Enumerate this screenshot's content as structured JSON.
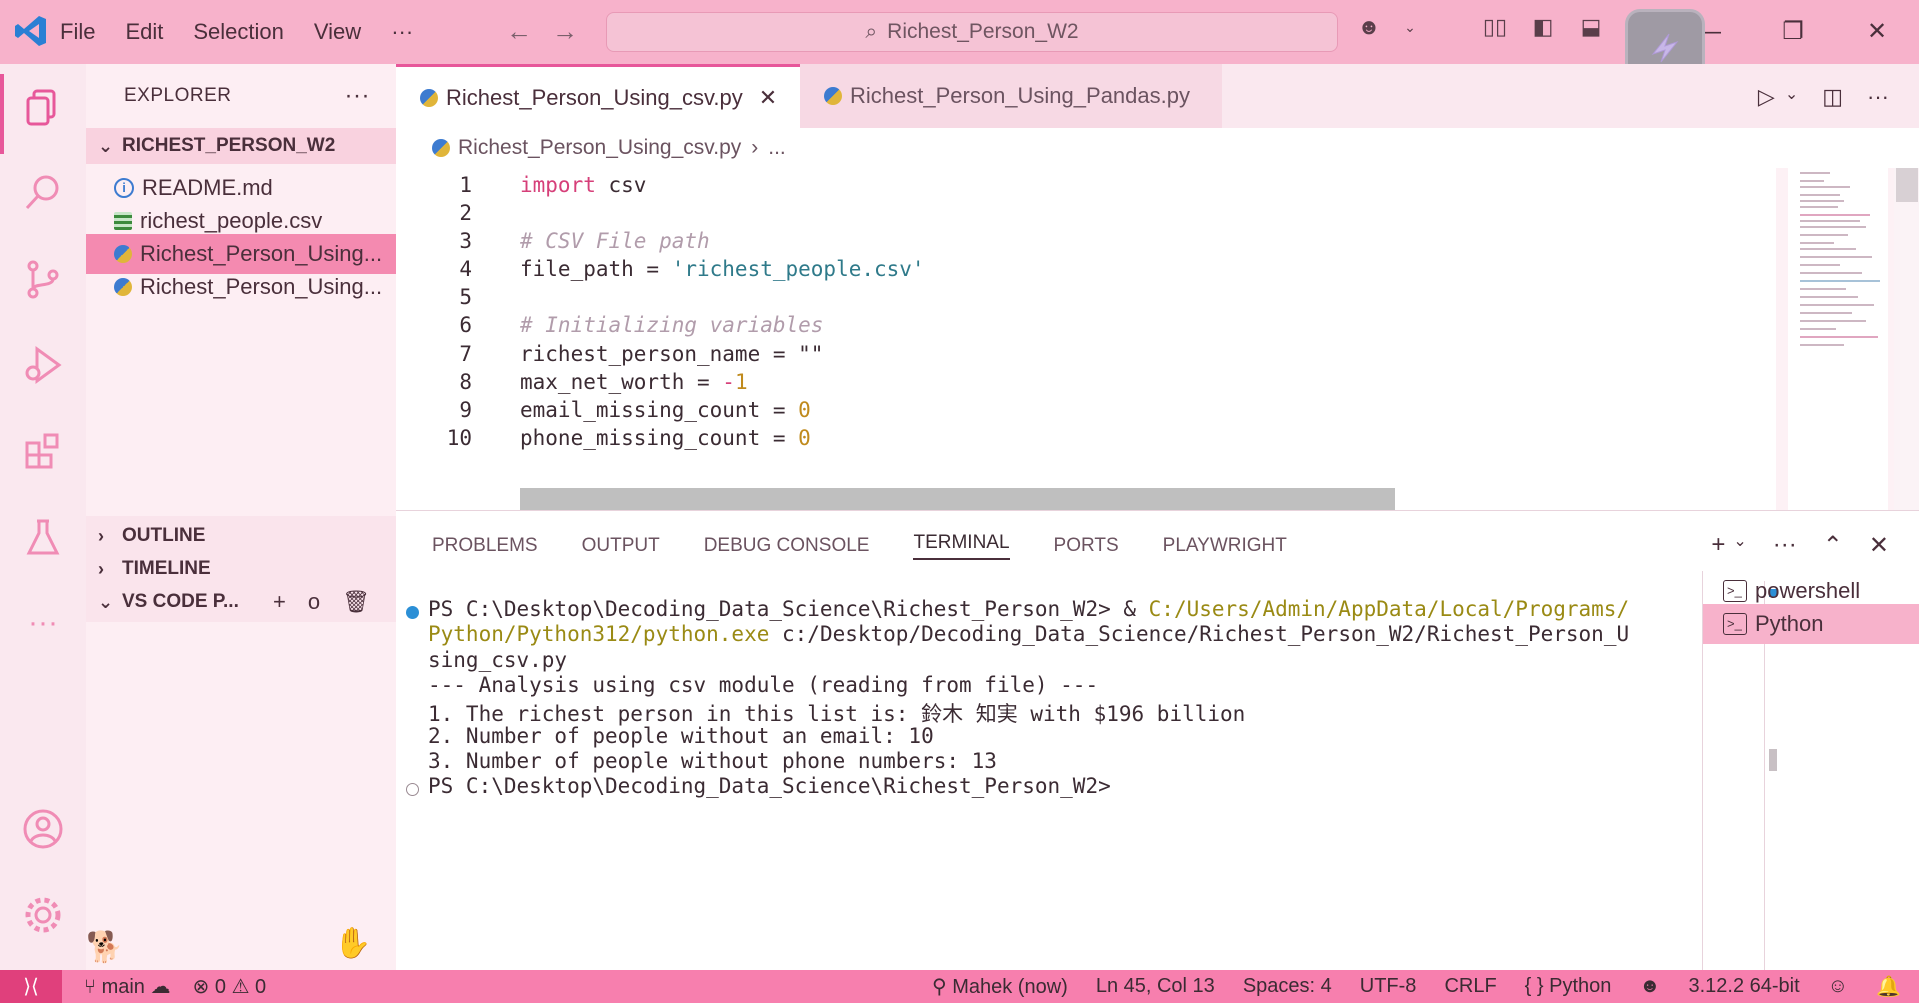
{
  "titlebar": {
    "menu": [
      "File",
      "Edit",
      "Selection",
      "View",
      "···"
    ],
    "search_text": "Richest_Person_W2"
  },
  "sidebar": {
    "header": "EXPLORER",
    "folder": "RICHEST_PERSON_W2",
    "files": [
      {
        "name": "README.md",
        "icon": "info-icon"
      },
      {
        "name": "richest_people.csv",
        "icon": "csv-icon"
      },
      {
        "name": "Richest_Person_Using...",
        "icon": "python-icon",
        "selected": true
      },
      {
        "name": "Richest_Person_Using...",
        "icon": "python-icon"
      }
    ],
    "sections": [
      "OUTLINE",
      "TIMELINE",
      "VS CODE P..."
    ]
  },
  "editor": {
    "tabs": [
      {
        "label": "Richest_Person_Using_csv.py",
        "active": true
      },
      {
        "label": "Richest_Person_Using_Pandas.py",
        "active": false
      }
    ],
    "breadcrumb_file": "Richest_Person_Using_csv.py",
    "breadcrumb_more": "...",
    "lines": [
      {
        "n": "1",
        "text": "import csv"
      },
      {
        "n": "2",
        "text": ""
      },
      {
        "n": "3",
        "text": "# CSV File path"
      },
      {
        "n": "4",
        "text": "file_path = 'richest_people.csv'"
      },
      {
        "n": "5",
        "text": ""
      },
      {
        "n": "6",
        "text": "# Initializing variables"
      },
      {
        "n": "7",
        "text": "richest_person_name = \"\""
      },
      {
        "n": "8",
        "text": "max_net_worth = -1"
      },
      {
        "n": "9",
        "text": "email_missing_count = 0"
      },
      {
        "n": "10",
        "text": "phone_missing_count = 0"
      }
    ]
  },
  "panel": {
    "tabs": [
      "PROBLEMS",
      "OUTPUT",
      "DEBUG CONSOLE",
      "TERMINAL",
      "PORTS",
      "PLAYWRIGHT"
    ],
    "active_tab": "TERMINAL",
    "terminal": {
      "line1_prompt": "PS C:\\Desktop\\Decoding_Data_Science\\Richest_Person_W2> & ",
      "line1_exe": "C:/Users/Admin/AppData/Local/Programs/",
      "line2_exe": "Python/Python312/python.exe",
      "line2_rest": " c:/Desktop/Decoding_Data_Science/Richest_Person_W2/Richest_Person_U",
      "line3": "sing_csv.py",
      "line4": "--- Analysis using csv module (reading from file) ---",
      "line5": "1. The richest person in this list is: 鈴木 知実 with $196 billion",
      "line6": "2. Number of people without an email: 10",
      "line7": "3. Number of people without phone numbers: 13",
      "line8": "PS C:\\Desktop\\Decoding_Data_Science\\Richest_Person_W2>"
    },
    "terminals": [
      {
        "label": "powershell",
        "active": false
      },
      {
        "label": "Python",
        "active": true
      }
    ]
  },
  "statusbar": {
    "branch": "main",
    "errors": "0",
    "warnings": "0",
    "author": "Mahek (now)",
    "position": "Ln 45, Col 13",
    "spaces": "Spaces: 4",
    "encoding": "UTF-8",
    "eol": "CRLF",
    "language": "Python",
    "interpreter": "3.12.2 64-bit"
  },
  "colors": {
    "accent": "#e7579a",
    "titlebar": "#f7b2cb",
    "statusbar": "#f77fae"
  }
}
